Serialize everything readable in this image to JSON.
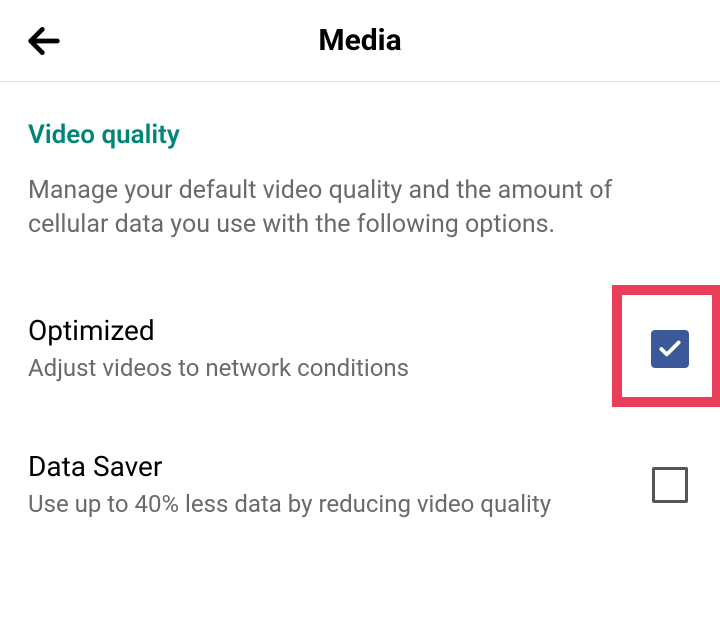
{
  "header": {
    "title": "Media"
  },
  "section": {
    "title": "Video quality",
    "description": "Manage your default video quality and the amount of cellular data you use with the following options."
  },
  "options": [
    {
      "title": "Optimized",
      "subtitle": "Adjust videos to network conditions",
      "checked": true,
      "highlighted": true
    },
    {
      "title": "Data Saver",
      "subtitle": "Use up to 40% less data by reducing video quality",
      "checked": false,
      "highlighted": false
    }
  ]
}
